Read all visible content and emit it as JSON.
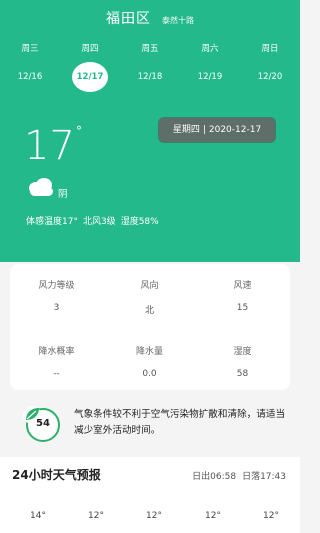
{
  "header": {
    "city": "福田区",
    "street": "泰然十路"
  },
  "days": [
    {
      "weekday": "周三",
      "date": "12/16",
      "active": false
    },
    {
      "weekday": "周四",
      "date": "12/17",
      "active": true
    },
    {
      "weekday": "周五",
      "date": "12/18",
      "active": false
    },
    {
      "weekday": "周六",
      "date": "12/19",
      "active": false
    },
    {
      "weekday": "周日",
      "date": "12/20",
      "active": false
    }
  ],
  "current": {
    "temperature": "17",
    "degree_symbol": "°",
    "weekday": "星期四",
    "date": "2020-12-17",
    "condition": "阴",
    "condition_icon": "cloud-icon",
    "feels_like": "体感温度17°",
    "wind": "北风3级",
    "humidity": "湿度58%"
  },
  "details": {
    "row1": [
      {
        "label": "风力等级",
        "value": "3"
      },
      {
        "label": "风向",
        "value": "北"
      },
      {
        "label": "风速",
        "value": "15"
      }
    ],
    "row2": [
      {
        "label": "降水概率",
        "value": "--"
      },
      {
        "label": "降水量",
        "value": "0.0"
      },
      {
        "label": "湿度",
        "value": "58"
      }
    ]
  },
  "air_quality": {
    "aqi": "54",
    "advice": "气象条件较不利于空气污染物扩散和清除，请适当减少室外活动时间。"
  },
  "forecast": {
    "title": "24小时天气预报",
    "sunrise": "日出06:58",
    "sunset": "日落17:43",
    "hours": [
      "14°",
      "12°",
      "12°",
      "12°",
      "12°"
    ]
  },
  "colors": {
    "primary": "#24b98a",
    "aqi_ring": "#2bb06a"
  }
}
